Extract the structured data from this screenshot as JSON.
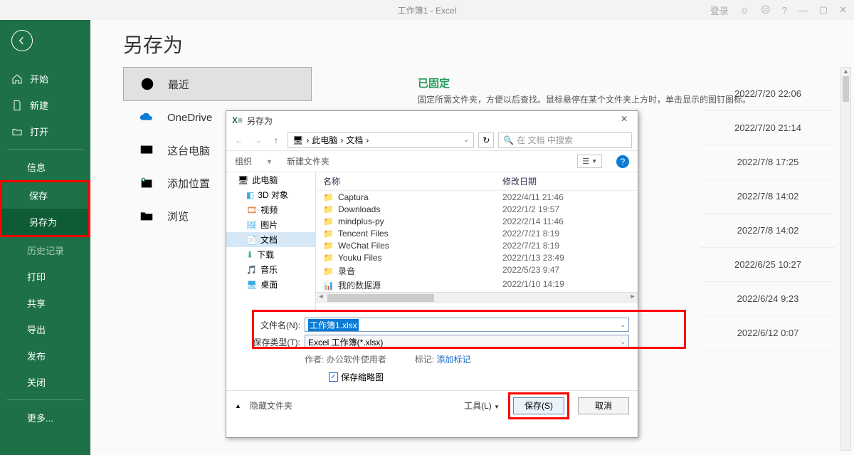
{
  "titlebar": {
    "title": "工作簿1  -  Excel",
    "login": "登录"
  },
  "main": {
    "heading": "另存为"
  },
  "green_sidebar": {
    "home": "开始",
    "new": "新建",
    "open": "打开",
    "info": "信息",
    "save": "保存",
    "saveas": "另存为",
    "history": "历史记录",
    "print": "打印",
    "share": "共享",
    "export": "导出",
    "publish": "发布",
    "close": "关闭",
    "more": "更多..."
  },
  "locations": {
    "recent": "最近",
    "onedrive": "OneDrive",
    "thispc": "这台电脑",
    "addplace": "添加位置",
    "browse": "浏览"
  },
  "pinned": {
    "title": "已固定",
    "subtitle": "固定所需文件夹，方便以后查找。鼠标悬停在某个文件夹上方时，单击显示的图钉图标。"
  },
  "recent_files": [
    "2022/7/20 22:06",
    "2022/7/20 21:14",
    "2022/7/8 17:25",
    "2022/7/8 14:02",
    "2022/7/8 14:02",
    "2022/6/25 10:27",
    "2022/6/24 9:23",
    "2022/6/12 0:07"
  ],
  "dialog": {
    "title": "另存为",
    "breadcrumb": {
      "a": "此电脑",
      "b": "文档"
    },
    "search_placeholder": "在 文档 中搜索",
    "organize": "组织",
    "new_folder": "新建文件夹",
    "col_name": "名称",
    "col_date": "修改日期",
    "tree": {
      "thispc": "此电脑",
      "objects3d": "3D 对象",
      "videos": "视频",
      "pictures": "图片",
      "documents": "文档",
      "downloads": "下载",
      "music": "音乐",
      "desktop": "桌面"
    },
    "files": [
      {
        "name": "Captura",
        "date": "2022/4/11 21:46"
      },
      {
        "name": "Downloads",
        "date": "2022/1/2 19:57"
      },
      {
        "name": "mindplus-py",
        "date": "2022/2/14 11:46"
      },
      {
        "name": "Tencent Files",
        "date": "2022/7/21 8:19"
      },
      {
        "name": "WeChat Files",
        "date": "2022/7/21 8:19"
      },
      {
        "name": "Youku Files",
        "date": "2022/1/13 23:49"
      },
      {
        "name": "录音",
        "date": "2022/5/23 9:47"
      },
      {
        "name": "我的数据源",
        "date": "2022/1/10 14:19"
      }
    ],
    "label_filename": "文件名(N):",
    "filename_value": "工作簿1.xlsx",
    "label_filetype": "保存类型(T):",
    "filetype_value": "Excel 工作簿(*.xlsx)",
    "author_label": "作者:",
    "author_value": "办公软件使用者",
    "tags_label": "标记:",
    "tags_value": "添加标记",
    "thumbnail": "保存缩略图",
    "hide_folders": "隐藏文件夹",
    "tools": "工具(L)",
    "save_btn": "保存(S)",
    "cancel_btn": "取消"
  }
}
